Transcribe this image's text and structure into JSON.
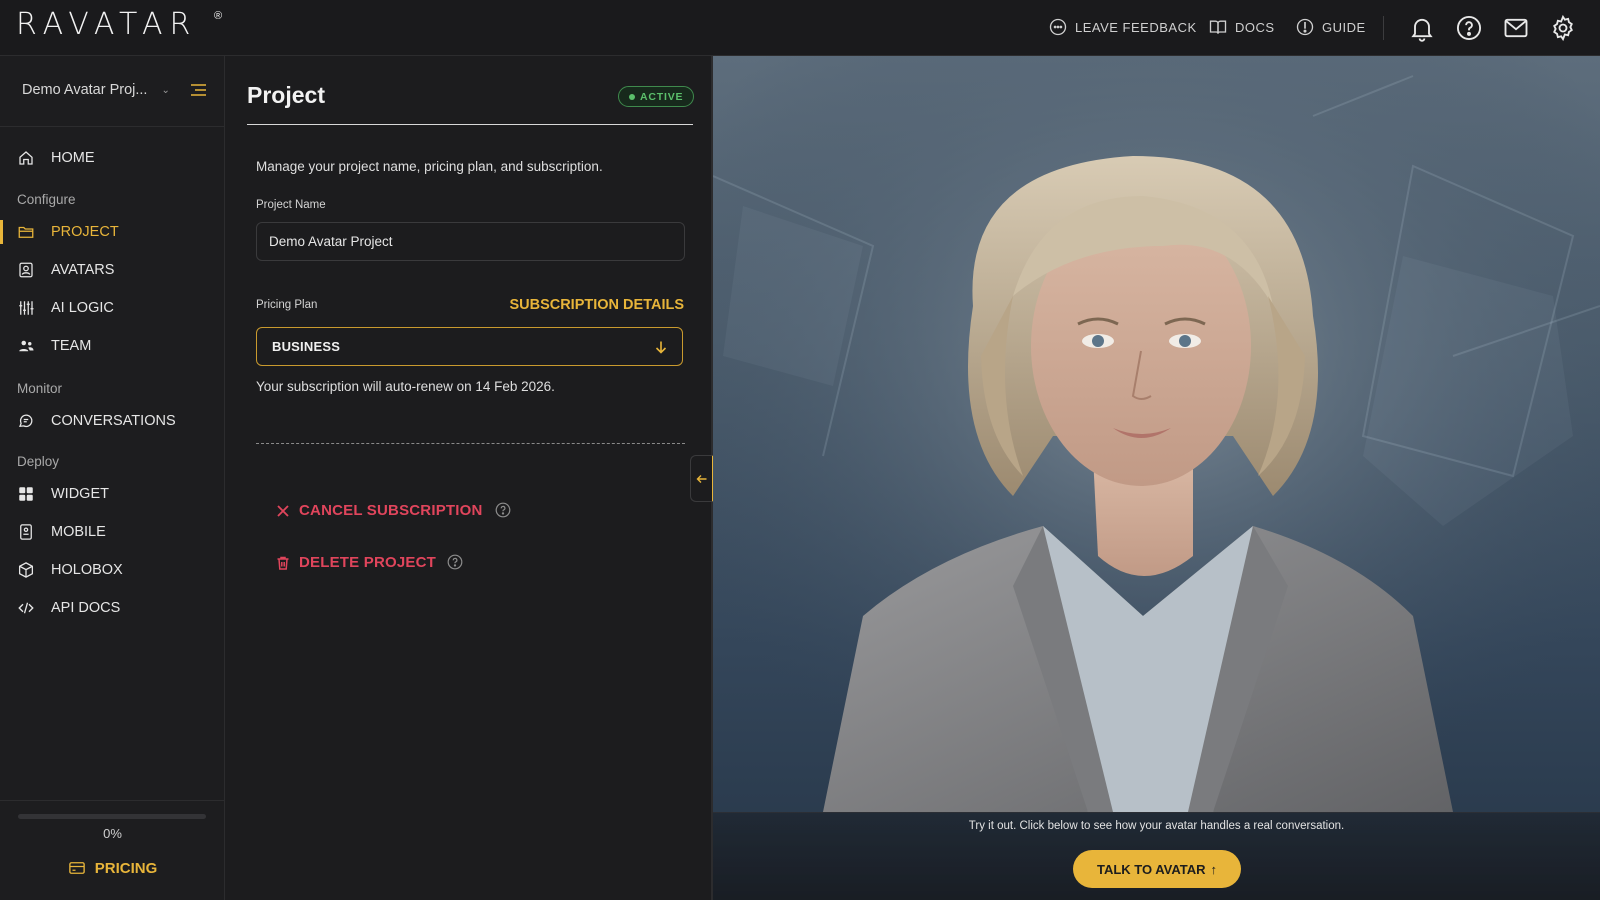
{
  "app": {
    "logo": "RAVATAR",
    "logo_mark": "®"
  },
  "topbar": {
    "links": [
      {
        "label": "LEAVE FEEDBACK",
        "icon": "feedback-icon"
      },
      {
        "label": "DOCS",
        "icon": "book-icon"
      },
      {
        "label": "GUIDE",
        "icon": "compass-icon"
      }
    ],
    "icons": [
      "bell-icon",
      "help-icon",
      "mail-icon",
      "gear-icon"
    ]
  },
  "sidebar": {
    "project_name": "Demo Avatar Proj...",
    "home": "HOME",
    "groups": {
      "configure": "Configure",
      "monitor": "Monitor",
      "deploy": "Deploy"
    },
    "items": {
      "project": "PROJECT",
      "avatars": "AVATARS",
      "ai_logic": "AI LOGIC",
      "team": "TEAM",
      "conversations": "CONVERSATIONS",
      "widget": "WIDGET",
      "mobile": "MOBILE",
      "holobox": "HOLOBOX",
      "api_docs": "API DOCS"
    },
    "progress_value": 0,
    "progress_label": "0%",
    "pricing_label": "PRICING"
  },
  "panel": {
    "title": "Project",
    "status": "ACTIVE",
    "description": "Manage your project name, pricing plan, and subscription.",
    "project_name_label": "Project Name",
    "project_name_value": "Demo Avatar Project",
    "pricing_plan_label": "Pricing Plan",
    "subscription_details": "SUBSCRIPTION DETAILS",
    "plan_value": "BUSINESS",
    "renew_text": "Your subscription will auto-renew on 14 Feb 2026.",
    "cancel_label": "CANCEL SUBSCRIPTION",
    "delete_label": "DELETE PROJECT"
  },
  "preview": {
    "hint": "Try it out. Click below to see how your avatar handles a real conversation.",
    "talk_label": "TALK TO AVATAR",
    "talk_icon": "↑"
  },
  "colors": {
    "accent": "#e8b53a",
    "danger": "#e0455c",
    "active": "#5bbf6b",
    "background": "#1c1c1e"
  }
}
